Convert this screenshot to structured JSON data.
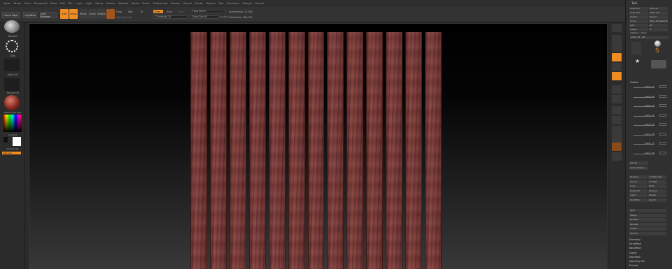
{
  "menubar": [
    "Alpha",
    "Brush",
    "Color",
    "Document",
    "Draw",
    "Edit",
    "File",
    "Layer",
    "Light",
    "Macro",
    "Marker",
    "Material",
    "Movie",
    "Picker",
    "Preferences",
    "Render",
    "Stencil",
    "Stroke",
    "Texture",
    "Tool",
    "Transform",
    "Zplugin",
    "Zscript"
  ],
  "toolbar": {
    "home": "Home Page",
    "lightbox": "LightBox",
    "live_boolean": "Live Boolean",
    "edit": "Edit",
    "draw": "Draw",
    "move": "Move",
    "scale": "Scale",
    "rotate": "Rotate",
    "mrgb": "Mrgb",
    "rgb": "Rgb",
    "m": "M",
    "rgb_intensity": "Rgb Intensity",
    "zadd": "Zadd",
    "zsub": "Zsub",
    "zcut": "Zcut",
    "z_intensity": "Z Intensity 25",
    "focal_shift": "Focal Shift 0",
    "draw_size": "Draw Size 64",
    "dynamic": "Dynamic",
    "active_points": "ActivePoints: 22,900",
    "total_points": "TotalPoints: 363,204"
  },
  "leftshelf": {
    "brush": "Standard",
    "stroke": "Dots",
    "alpha": "Alpha Off",
    "texture": "Texture Off",
    "material": "MatCap Red Wax",
    "gradient": "Gradient",
    "switch_color": "SwitchColor",
    "alternate": "Alternate"
  },
  "panel": {
    "title": "Tool",
    "buttons": [
      "Load Tool",
      "Save As",
      "Copy Tool",
      "Paste Tool",
      "Import",
      "Export",
      "Clone",
      "Make PolyMesh3D",
      "GoZ",
      "All",
      "Visible",
      "R"
    ],
    "lightbox_tools": "Lightbox ▸ Tools",
    "current_tool": "plank_01 . 46",
    "tool_thumbs": [
      "plank_07",
      "SphereBrush",
      "PolyMesh3D",
      "SimpleBrush",
      "Cylinder3D",
      "plank_07"
    ],
    "subtool_header": "Subtool",
    "subtools": [
      "plank_11",
      "plank_12",
      "plank_13",
      "plank_14",
      "plank_15",
      "plank_16",
      "plank_17",
      "plank_18"
    ],
    "list_all": "List All",
    "auto_collapse": "Auto Collapse",
    "ops": [
      "Rename",
      "AutoReorder",
      "All Low",
      "All High",
      "Copy",
      "Paste",
      "Duplicate",
      "Append",
      "Insert",
      "Delete",
      "Del Other",
      "Del All",
      "Split",
      "Merge",
      "Boolean",
      "Remesh",
      "Project",
      "Extract"
    ],
    "sections": [
      "Geometry",
      "ArrayMesh",
      "NanoMesh",
      "Layers",
      "FiberMesh",
      "Geometry HD",
      "Preview"
    ]
  },
  "colors": {
    "accent": "#ef8c23",
    "wood": "#7d3c3a",
    "panel": "#303030"
  },
  "planks_count": 13
}
